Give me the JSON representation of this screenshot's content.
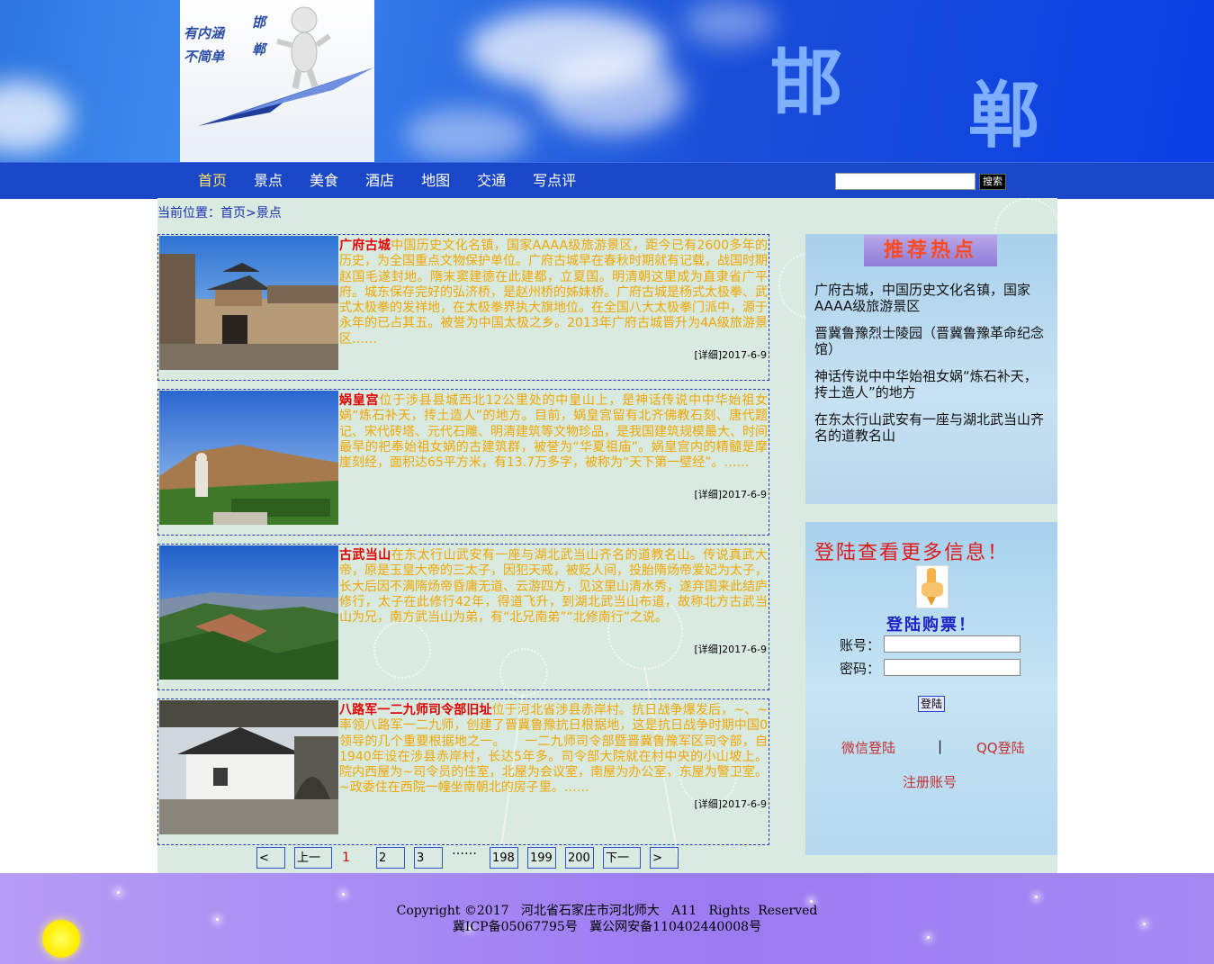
{
  "header": {
    "logo_text_left": "有内涵 不简单",
    "logo_text_right": "邯 郸",
    "city_char_1": "邯",
    "city_char_2": "郸"
  },
  "nav": {
    "items": [
      "首页",
      "景点",
      "美食",
      "酒店",
      "地图",
      "交通",
      "写点评"
    ],
    "active_index": 0,
    "search": {
      "value": "",
      "button_label": "搜索"
    }
  },
  "breadcrumb": "当前位置：首页>景点",
  "articles": [
    {
      "title": "广府古城",
      "body": "中国历史文化名镇，国家AAAA级旅游景区，距今已有2600多年的历史，为全国重点文物保护单位。广府古城早在春秋时期就有记载，战国时期赵国毛遂封地。隋末窦建德在此建都，立夏国。明清朝这里成为直隶省广平府。城东保存完好的弘济桥，是赵州桥的姊妹桥。广府古城是杨式太极拳、武式太极拳的发祥地，在太极拳界执大旗地位。在全国八大太极拳门派中，源于永年的已占其五。被誉为中国太极之乡。2013年广府古城晋升为4A级旅游景区……",
      "detail": "[详细]2017-6-9"
    },
    {
      "title": "娲皇宫",
      "body": "位于涉县县城西北12公里处的中皇山上，是神话传说中中华始祖女娲“炼石补天，抟土造人”的地方。目前，娲皇宫留有北齐佛教石刻、唐代题记、宋代砖塔、元代石雕、明清建筑等文物珍品，是我国建筑规模最大、时间最早的祀奉始祖女娲的古建筑群，被誉为“华夏祖庙”。娲皇宫内的精髓是摩崖刻经，面积达65平方米，有13.7万多字，被称为“天下第一壁经”。……",
      "detail": "[详细]2017-6-9"
    },
    {
      "title": "古武当山",
      "body": "在东太行山武安有一座与湖北武当山齐名的道教名山。传说真武大帝，原是玉皇大帝的三太子，因犯天戒，被贬人间，投胎隋炀帝爱妃为太子，长大后因不满隋炀帝昏庸无道、云游四方，见这里山清水秀，遂弃国来此结庐修行，太子在此修行42年，得道飞升，到湖北武当山布道，故称北方古武当山为兄，南方武当山为弟，有“北兄南弟”“北修南行”之说。",
      "detail": "[详细]2017-6-9"
    },
    {
      "title": "八路军一二九师司令部旧址",
      "body": "位于河北省涉县赤岸村。抗日战争爆发后，~、~率领八路军一二九师，创建了晋冀鲁豫抗日根据地，这是抗日战争时期中国0领导的几个重要根据地之一。　　一二九师司令部暨晋冀鲁豫军区司令部，自1940年设在涉县赤岸村，长达5年多。司令部大院就在村中央的小山坡上。院内西屋为~司令员的住室，北屋为会议室，南屋为办公室，东屋为警卫室。~政委住在西院一幢坐南朝北的房子里。……",
      "detail": "[详细]2017-6-9"
    }
  ],
  "pagination": {
    "prev_icon_label": "<",
    "prev_label": "上一页",
    "current": "1",
    "pages_a": [
      "2",
      "3"
    ],
    "ellipsis": "……",
    "pages_b": [
      "198",
      "199",
      "200"
    ],
    "next_label": "下一页",
    "next_icon_label": ">"
  },
  "hot": {
    "badge": "推荐热点",
    "items": [
      "广府古城，中国历史文化名镇，国家AAAA级旅游景区",
      "晋冀鲁豫烈士陵园（晋冀鲁豫革命纪念馆）",
      "神话传说中中华始祖女娲“炼石补天，抟土造人”的地方",
      "在东太行山武安有一座与湖北武当山齐名的道教名山"
    ]
  },
  "login": {
    "heading": "登陆查看更多信息！",
    "buy_heading": "登陆购票！",
    "account_label": "账号：",
    "password_label": "密码：",
    "account_value": "",
    "password_value": "",
    "submit_label": "登陆",
    "wechat_label": "微信登陆",
    "separator": "|",
    "qq_label": "QQ登陆",
    "register_label": "注册账号"
  },
  "footer": {
    "line1": "Copyright ©2017   河北省石家庄市河北师大   A11   Rights  Reserved",
    "line2": "冀ICP备05067795号   冀公网安备110402440008号"
  },
  "colors": {
    "nav_bg": "#1a47c8",
    "nav_active": "#ffe066",
    "article_title": "#e00000",
    "article_body": "#f0a500",
    "main_bg": "#d9ebe0",
    "footer_bg": "#a98cf4"
  }
}
